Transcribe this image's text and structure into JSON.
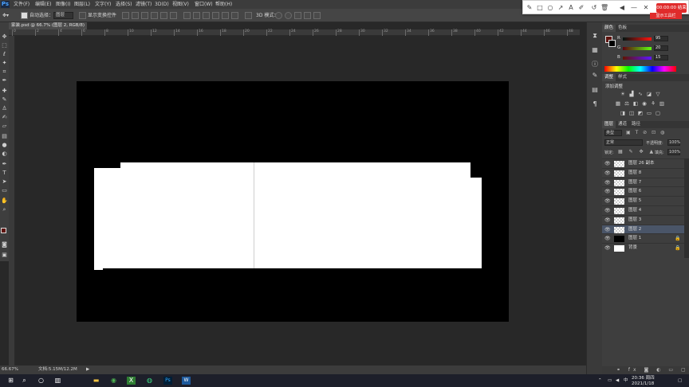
{
  "menubar": {
    "logo": "Ps",
    "items": [
      "文件(F)",
      "编辑(E)",
      "图像(I)",
      "图层(L)",
      "文字(Y)",
      "选择(S)",
      "滤镜(T)",
      "3D(D)",
      "视图(V)",
      "窗口(W)",
      "帮助(H)"
    ]
  },
  "options": {
    "auto_select_label": "自动选择：",
    "auto_select_value": "图层",
    "show_transform_label": "显示变换控件",
    "mode_3d_label": "3D 模式："
  },
  "recorder": {
    "button": "00:00:00 结束",
    "sub": "显示工具栏"
  },
  "document": {
    "tab_title": "家装.psd @ 66.7% (图层 2, RGB/8)",
    "ruler_labels": [
      "0",
      "2",
      "4",
      "6",
      "8",
      "10",
      "12",
      "14",
      "16",
      "18",
      "20",
      "22",
      "24",
      "26",
      "28",
      "30",
      "32",
      "34",
      "36",
      "38",
      "40",
      "42",
      "44",
      "46",
      "48"
    ]
  },
  "status": {
    "zoom": "66.67%",
    "doc_info": "文档:5.15M/12.2M"
  },
  "color_panel": {
    "tabs": [
      "颜色",
      "色板"
    ],
    "r_label": "R",
    "g_label": "G",
    "b_label": "B",
    "r": "95",
    "g": "20",
    "b": "15",
    "fg_color": "#5f140f"
  },
  "adjust_panel": {
    "tabs": [
      "调整",
      "样式"
    ],
    "title": "添加调整"
  },
  "layers_panel": {
    "tabs": [
      "图层",
      "通道",
      "路径"
    ],
    "kind_label": "类型",
    "blend_mode": "正常",
    "opacity_label": "不透明度:",
    "opacity": "100%",
    "lock_label": "锁定:",
    "fill_label": "填充:",
    "fill": "100%",
    "layers": [
      {
        "name": "图层 26 副本",
        "selected": false,
        "kind": "checker",
        "lock": false
      },
      {
        "name": "图层 8",
        "selected": false,
        "kind": "checker",
        "lock": false
      },
      {
        "name": "图层 7",
        "selected": false,
        "kind": "checker",
        "lock": false
      },
      {
        "name": "图层 6",
        "selected": false,
        "kind": "checker",
        "lock": false
      },
      {
        "name": "图层 5",
        "selected": false,
        "kind": "checker",
        "lock": false
      },
      {
        "name": "图层 4",
        "selected": false,
        "kind": "checker",
        "lock": false
      },
      {
        "name": "图层 3",
        "selected": false,
        "kind": "checker",
        "lock": false
      },
      {
        "name": "图层 2",
        "selected": true,
        "kind": "checker",
        "lock": false
      },
      {
        "name": "图层 1",
        "selected": false,
        "kind": "black",
        "lock": true
      },
      {
        "name": "背景",
        "selected": false,
        "kind": "white",
        "lock": true
      }
    ]
  },
  "taskbar": {
    "time": "20:36 周四",
    "date": "2021/1/18",
    "lang": "中"
  }
}
